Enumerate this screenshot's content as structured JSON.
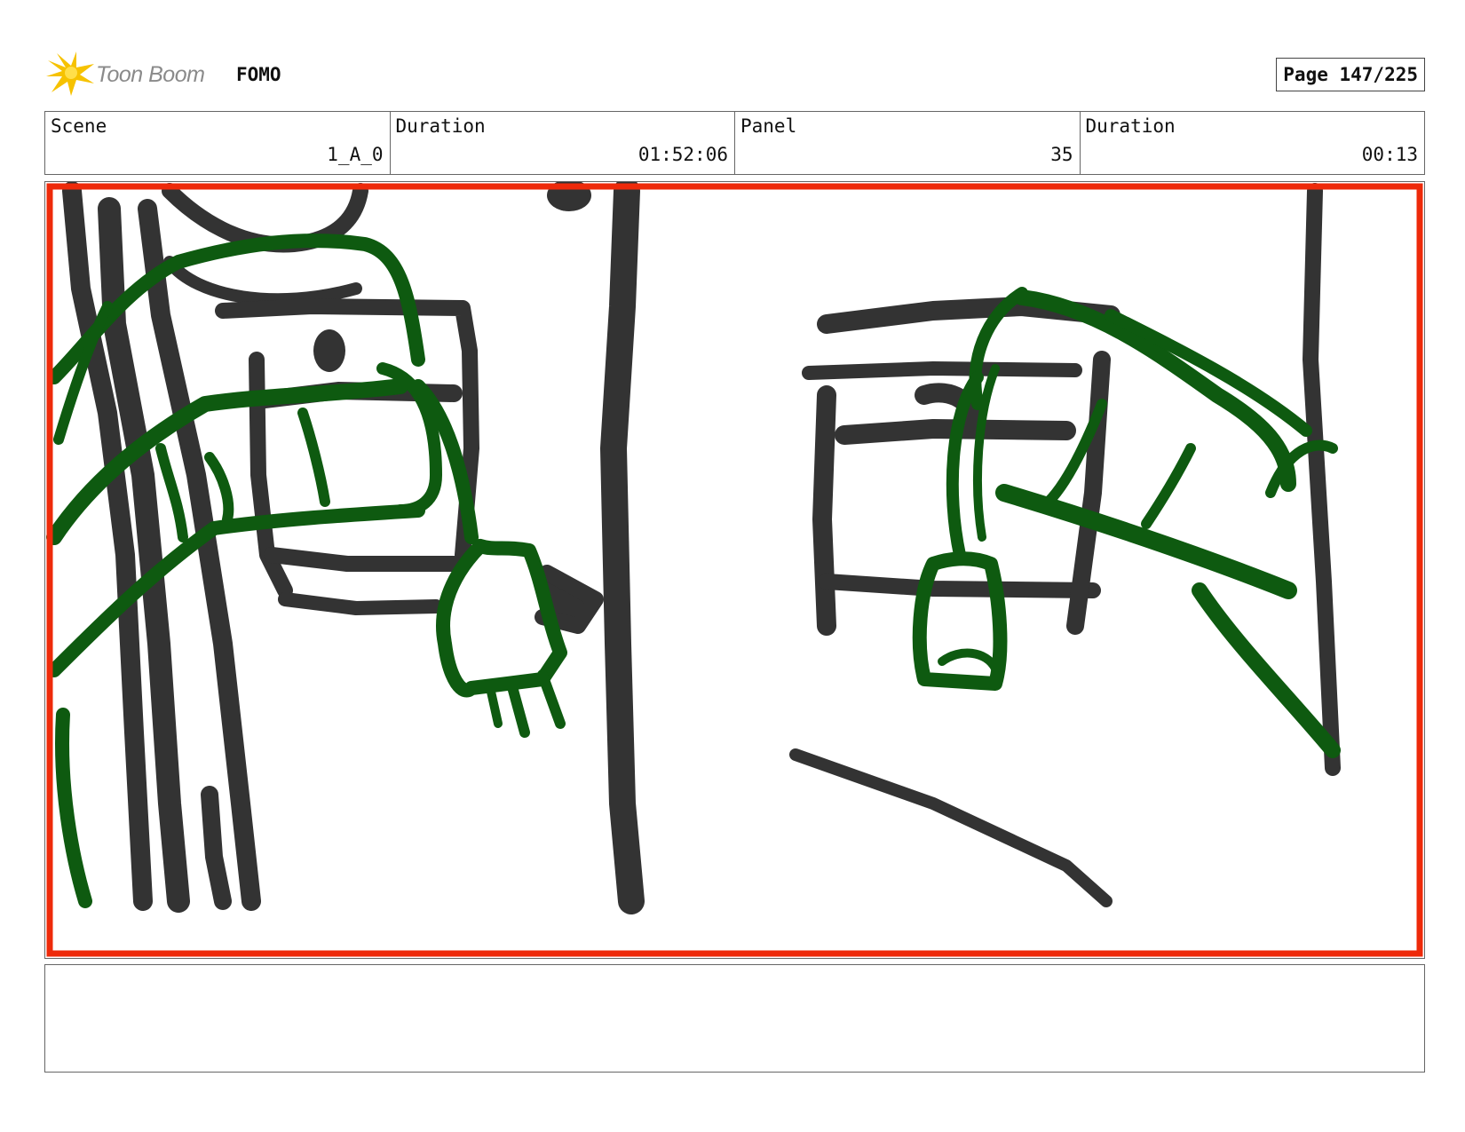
{
  "header": {
    "logo_text": "Toon Boom",
    "project": "FOMO",
    "page": "Page 147/225"
  },
  "info": [
    {
      "label": "Scene",
      "value": "1_A_0"
    },
    {
      "label": "Duration",
      "value": "01:52:06"
    },
    {
      "label": "Panel",
      "value": "35"
    },
    {
      "label": "Duration",
      "value": "00:13"
    }
  ],
  "colors": {
    "sketch_dark": "#333333",
    "sketch_green": "#0e5a10",
    "frame_red": "#ee2a0a"
  },
  "notes": ""
}
